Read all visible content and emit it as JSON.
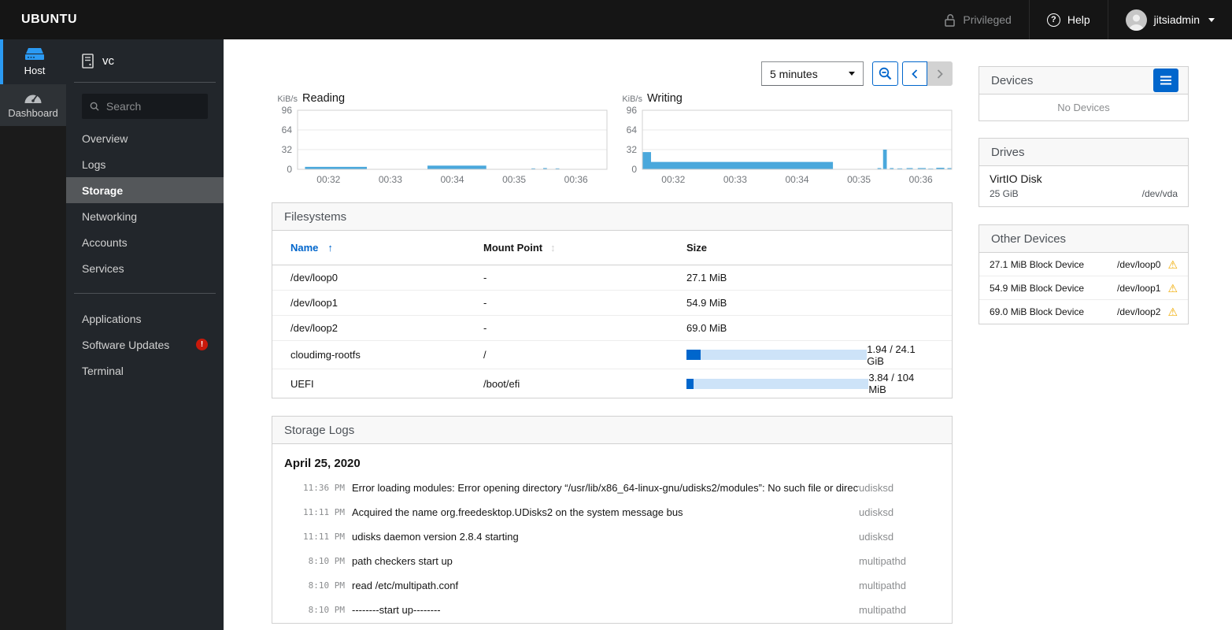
{
  "navbar": {
    "brand": "UBUNTU",
    "privileged_label": "Privileged",
    "help_label": "Help",
    "help_icon_glyph": "?",
    "username": "jitsiadmin"
  },
  "rail": {
    "host_label": "Host",
    "dashboard_label": "Dashboard"
  },
  "sidebar": {
    "hostname": "vc",
    "search_placeholder": "Search",
    "menu_primary": [
      "Overview",
      "Logs",
      "Storage",
      "Networking",
      "Accounts",
      "Services"
    ],
    "menu_secondary": [
      "Applications",
      "Software Updates",
      "Terminal"
    ],
    "selected_item": "Storage",
    "updates_badge_glyph": "!"
  },
  "toolbar": {
    "range_value": "5 minutes"
  },
  "chart_data": [
    {
      "type": "area",
      "title": "Reading",
      "ylabel": "KiB/s",
      "ylim": [
        0,
        96
      ],
      "yticks": [
        0,
        32,
        64,
        96
      ],
      "xtick_minutes": [
        32,
        33,
        34,
        35,
        36
      ],
      "xtick_labels": [
        "00:32",
        "00:33",
        "00:34",
        "00:35",
        "00:36"
      ],
      "x_range": [
        31.5,
        36.5
      ],
      "color": "#4aa8dc",
      "segments": [
        [
          31.62,
          32.62,
          4
        ],
        [
          33.6,
          34.55,
          6
        ],
        [
          35.28,
          35.34,
          1.5
        ],
        [
          35.47,
          35.53,
          2
        ],
        [
          35.67,
          35.73,
          1.5
        ]
      ]
    },
    {
      "type": "area",
      "title": "Writing",
      "ylabel": "KiB/s",
      "ylim": [
        0,
        96
      ],
      "yticks": [
        0,
        32,
        64,
        96
      ],
      "xtick_minutes": [
        32,
        33,
        34,
        35,
        36
      ],
      "xtick_labels": [
        "00:32",
        "00:33",
        "00:34",
        "00:35",
        "00:36"
      ],
      "x_range": [
        31.5,
        36.5
      ],
      "color": "#4aa8dc",
      "segments": [
        [
          31.5,
          31.64,
          28
        ],
        [
          31.64,
          34.58,
          12
        ],
        [
          35.3,
          35.36,
          2
        ],
        [
          35.39,
          35.45,
          32
        ],
        [
          35.5,
          35.56,
          2
        ],
        [
          35.62,
          35.7,
          1.5
        ],
        [
          35.77,
          35.87,
          2
        ],
        [
          35.95,
          36.08,
          2
        ],
        [
          36.12,
          36.2,
          1.2
        ],
        [
          36.25,
          36.38,
          2.5
        ],
        [
          36.43,
          36.5,
          2
        ]
      ]
    }
  ],
  "filesystems": {
    "title": "Filesystems",
    "columns": [
      "Name",
      "Mount Point",
      "Size"
    ],
    "sort_asc_glyph": "↑",
    "sort_both_glyph": "↕",
    "rows": [
      {
        "name": "/dev/loop0",
        "mount": "-",
        "size": "27.1 MiB"
      },
      {
        "name": "/dev/loop1",
        "mount": "-",
        "size": "54.9 MiB"
      },
      {
        "name": "/dev/loop2",
        "mount": "-",
        "size": "69.0 MiB"
      },
      {
        "name": "cloudimg-rootfs",
        "mount": "/",
        "size": "1.94 / 24.1 GiB",
        "used_pct": 8
      },
      {
        "name": "UEFI",
        "mount": "/boot/efi",
        "size": "3.84 / 104 MiB",
        "used_pct": 3.7
      }
    ]
  },
  "storage_logs": {
    "title": "Storage Logs",
    "date": "April 25, 2020",
    "entries": [
      {
        "time": "11:36 PM",
        "message": "Error loading modules: Error opening directory “/usr/lib/x86_64-linux-gnu/udisks2/modules”: No such file or directory",
        "service": "udisksd"
      },
      {
        "time": "11:11 PM",
        "message": "Acquired the name org.freedesktop.UDisks2 on the system message bus",
        "service": "udisksd"
      },
      {
        "time": "11:11 PM",
        "message": "udisks daemon version 2.8.4 starting",
        "service": "udisksd"
      },
      {
        "time": "8:10 PM",
        "message": "path checkers start up",
        "service": "multipathd"
      },
      {
        "time": "8:10 PM",
        "message": "read /etc/multipath.conf",
        "service": "multipathd"
      },
      {
        "time": "8:10 PM",
        "message": "--------start up--------",
        "service": "multipathd"
      }
    ]
  },
  "devices_panel": {
    "title": "Devices",
    "empty_label": "No Devices"
  },
  "drives_panel": {
    "title": "Drives",
    "items": [
      {
        "name": "VirtIO Disk",
        "size": "25 GiB",
        "path": "/dev/vda"
      }
    ]
  },
  "other_devices_panel": {
    "title": "Other Devices",
    "warning_glyph": "⚠",
    "items": [
      {
        "name": "27.1 MiB Block Device",
        "path": "/dev/loop0"
      },
      {
        "name": "54.9 MiB Block Device",
        "path": "/dev/loop1"
      },
      {
        "name": "69.0 MiB Block Device",
        "path": "/dev/loop2"
      }
    ]
  },
  "colors": {
    "accent": "#0066cc",
    "chart_bar": "#4aa8dc",
    "warning": "#f0ab00",
    "error": "#c9190b",
    "rail_active": "#2b9af3"
  }
}
